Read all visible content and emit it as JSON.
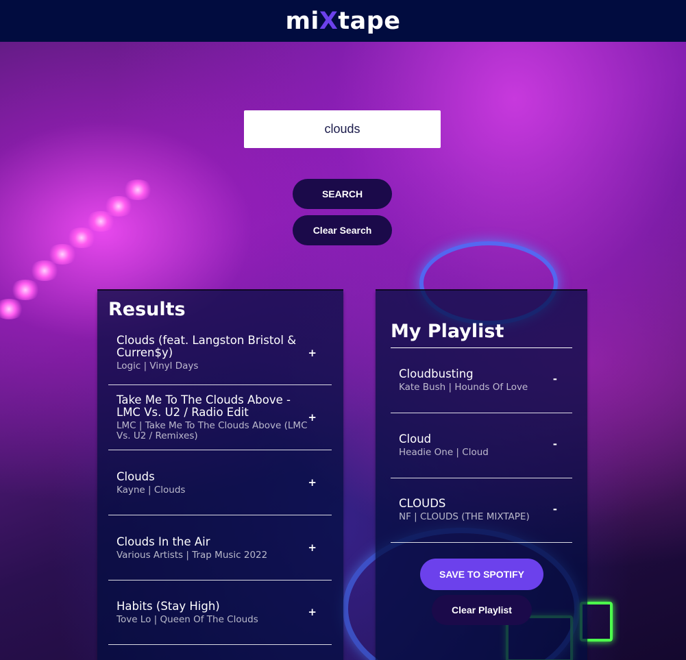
{
  "header": {
    "logo_prefix": "mi",
    "logo_x": "X",
    "logo_suffix": "tape"
  },
  "search": {
    "value": "clouds",
    "search_label": "SEARCH",
    "clear_label": "Clear Search"
  },
  "results": {
    "title": "Results",
    "add_symbol": "+",
    "tracks": [
      {
        "name": "Clouds (feat. Langston Bristol & Curren$y)",
        "info": "Logic | Vinyl Days"
      },
      {
        "name": "Take Me To The Clouds Above - LMC Vs. U2 / Radio Edit",
        "info": "LMC | Take Me To The Clouds Above (LMC Vs. U2 / Remixes)"
      },
      {
        "name": "Clouds",
        "info": "Kayne | Clouds"
      },
      {
        "name": "Clouds In the Air",
        "info": "Various Artists | Trap Music 2022"
      },
      {
        "name": "Habits (Stay High)",
        "info": "Tove Lo | Queen Of The Clouds"
      }
    ]
  },
  "playlist": {
    "title": "My Playlist",
    "remove_symbol": "-",
    "tracks": [
      {
        "name": "Cloudbusting",
        "info": "Kate Bush | Hounds Of Love"
      },
      {
        "name": "Cloud",
        "info": "Headie One | Cloud"
      },
      {
        "name": "CLOUDS",
        "info": "NF | CLOUDS (THE MIXTAPE)"
      }
    ],
    "save_label": "SAVE TO SPOTIFY",
    "clear_label": "Clear Playlist"
  },
  "colors": {
    "header_bg": "#010c3f",
    "accent": "#6c41ec",
    "button_dark": "#1b0a4a"
  }
}
